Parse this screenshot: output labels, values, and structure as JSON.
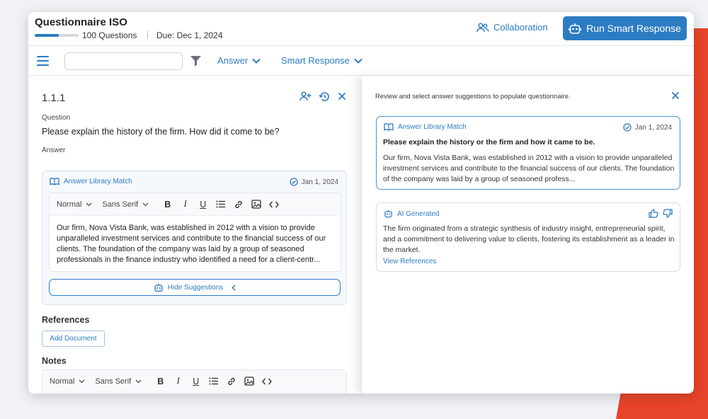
{
  "colors": {
    "accent": "#2c7cc2",
    "decoration": "#e8442a"
  },
  "header": {
    "title": "Questionnaire ISO",
    "progress_fraction": 0.55,
    "question_count": "100 Questions",
    "due_date": "Due: Dec 1, 2024",
    "collaboration_label": "Collaboration",
    "run_button_label": "Run Smart Response"
  },
  "toolbar": {
    "search_value": "",
    "answer_dropdown": "Answer",
    "smart_response_dropdown": "Smart Response"
  },
  "question_panel": {
    "number": "1.1.1",
    "question_label": "Question",
    "question_text": "Please explain the history of the firm. How did it come to be?",
    "answer_label": "Answer",
    "answer": {
      "source_label": "Answer Library Match",
      "date": "Jan 1, 2024",
      "editor_style": "Normal",
      "editor_font": "Sans Serif",
      "text": "Our firm, Nova Vista Bank, was established in 2012 with a vision to provide unparalleled investment services and contribute to the financial success of our clients. The foundation of the company was laid by a group of seasoned professionals in the finance industry who identified a need for a client-centr..."
    },
    "hide_suggestions_label": "Hide Suggestions",
    "references_label": "References",
    "add_document_label": "Add Document",
    "notes_label": "Notes",
    "notes_editor": {
      "editor_style": "Normal",
      "editor_font": "Sans Serif"
    }
  },
  "suggestions_panel": {
    "instructions": "Review and select answer suggestions to populate questionnaire.",
    "cards": [
      {
        "source_label": "Answer Library Match",
        "date": "Jan 1, 2024",
        "title": "Please explain the history or the firm and how it came to be.",
        "body": "Our firm, Nova Vista Bank, was established in 2012 with a vision to provide unparalleled investment services and contribute to the financial success of our clients. The foundation of the company was laid by a group of seasoned profess..."
      },
      {
        "source_label": "AI Generated",
        "body": "The firm originated from a strategic synthesis of industry insight, entrepreneurial spirit, and a commitment to delivering value to clients, fostering its establishment as a leader in the market.",
        "link_label": "View References"
      }
    ]
  }
}
